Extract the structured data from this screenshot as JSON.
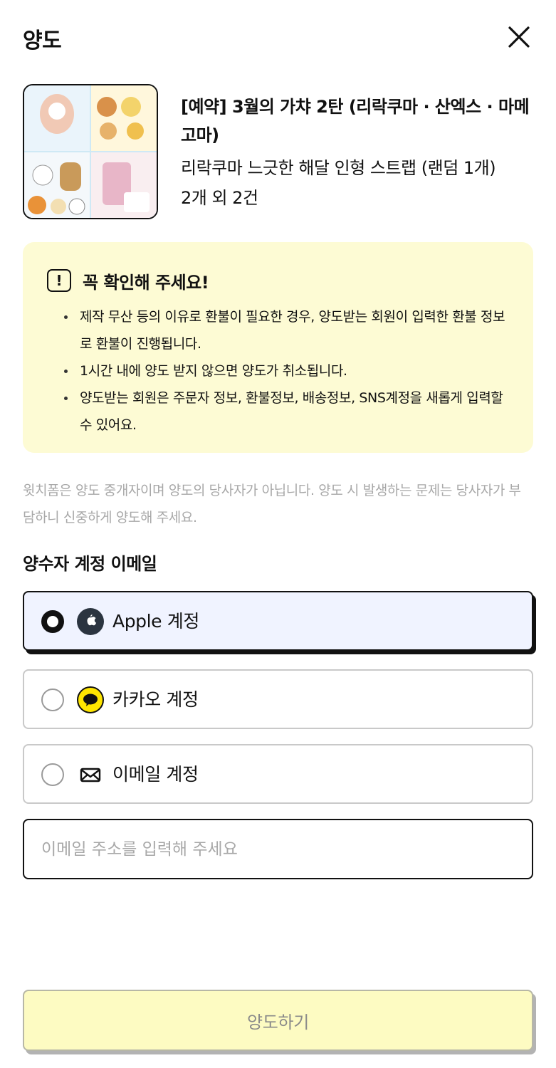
{
  "header": {
    "title": "양도"
  },
  "product": {
    "name": "[예약] 3월의 가챠 2탄 (리락쿠마 · 산엑스 · 마메고마)",
    "option": "리락쿠마 느긋한 해달 인형 스트랩 (랜덤 1개)",
    "count": "2개 외 2건"
  },
  "notice": {
    "title": "꼭 확인해 주세요!",
    "items": [
      "제작 무산 등의 이유로 환불이 필요한 경우, 양도받는 회원이 입력한 환불 정보로 환불이 진행됩니다.",
      "1시간 내에 양도 받지 않으면 양도가 취소됩니다.",
      "양도받는 회원은 주문자 정보, 환불정보, 배송정보, SNS계정을 새롭게 입력할 수 있어요."
    ]
  },
  "disclaimer": "윗치폼은 양도 중개자이며 양도의 당사자가 아닙니다. 양도 시 발생하는 문제는 당사자가 부담하니 신중하게 양도해 주세요.",
  "account": {
    "label": "양수자 계정 이메일",
    "options": [
      {
        "label": "Apple 계정",
        "icon": "apple-icon",
        "selected": true
      },
      {
        "label": "카카오 계정",
        "icon": "kakao-icon",
        "selected": false
      },
      {
        "label": "이메일 계정",
        "icon": "envelope-icon",
        "selected": false
      }
    ],
    "email_placeholder": "이메일 주소를 입력해 주세요"
  },
  "submit_label": "양도하기",
  "colors": {
    "notice_bg": "#fdfbd4",
    "selected_bg": "#f0f3ff",
    "submit_bg": "#fdfbc2",
    "kakao_yellow": "#fee500",
    "apple_dark": "#2b3440"
  }
}
